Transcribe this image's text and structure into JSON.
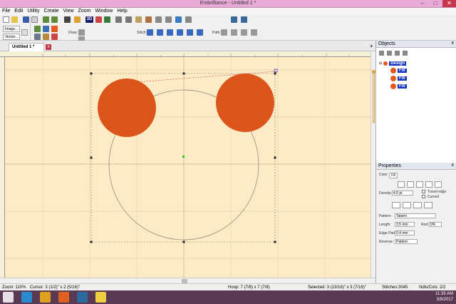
{
  "window": {
    "title": "Embrilliance - Untitled 1 *",
    "minimize": "–",
    "maximize": "□",
    "close": "✕"
  },
  "menu": [
    "File",
    "Edit",
    "Utility",
    "Create",
    "View",
    "Zoom",
    "Window",
    "Help"
  ],
  "toolbar": {
    "image_label": "Image...",
    "vector_label": "Vector...",
    "draw_label": "Draw:",
    "stitch_label": "Stitch:",
    "path_label": "Path:",
    "view_3d": "3D"
  },
  "document_tab": {
    "label": "Untitled 1 *",
    "close": "x"
  },
  "objects_panel": {
    "title": "Objects",
    "close": "x",
    "tree": [
      {
        "label": "Design"
      },
      {
        "label": "Fill",
        "color": "#e25a1c"
      },
      {
        "label": "Fill",
        "color": "#e25a1c"
      },
      {
        "label": "Fill",
        "color": "#e25a1c"
      }
    ]
  },
  "properties_panel": {
    "title": "Properties",
    "close": "x",
    "tabs": [
      "Color",
      "Fill"
    ],
    "density_label": "Density:",
    "density_value": "4.0 pt",
    "travel_edge_label": "Travel edge",
    "curved_label": "Curved",
    "pattern_label": "Pattern:",
    "pattern_value": "Tatami",
    "length_label": "Length:",
    "length_value": "3.5 mm",
    "rnd_label": "Rnd:",
    "rnd_value": "0%",
    "edge_pad_label": "Edge Pad:",
    "edge_pad_value": "0.4 mm",
    "reverse_label": "Reverse:",
    "reverse_value": "Pattern"
  },
  "status": {
    "zoom": "Zoom: 110%",
    "cursor": "Cursor: 3 (1/2)\" x 2 (5/16)\"",
    "hoop": "Hoop: 7 (7/8) x 7 (7/8)",
    "selected": "Selected: 3 (13/16)\" x 3 (7/16)\"",
    "stitches": "Stitches:3045",
    "ndls": "Ndls/Cols: 2/2"
  },
  "taskbar": {
    "time": "11:35 AM",
    "date": "3/8/2017"
  },
  "colors": {
    "fill": "#e25a1c",
    "canvas": "#fcebc5",
    "titlebar": "#e7a9d6",
    "taskbar": "#5a3a52"
  }
}
